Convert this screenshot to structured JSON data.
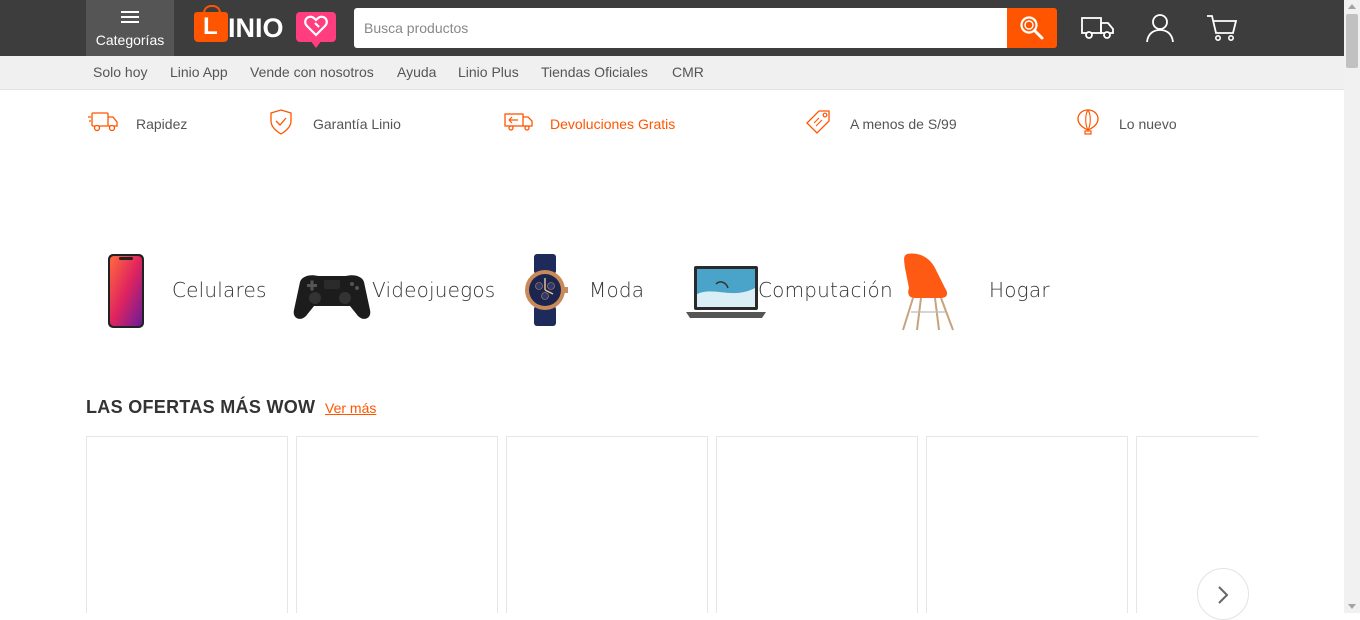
{
  "header": {
    "categories_label": "Categorías",
    "logo_text": "LINIO",
    "search_placeholder": "Busca productos",
    "icons": [
      "menu-icon",
      "search-icon",
      "truck-icon",
      "user-icon",
      "cart-icon"
    ],
    "accent_color": "#ff5500",
    "brand_pink": "#ff3d7f"
  },
  "subnav": {
    "items": [
      "Solo hoy",
      "Linio App",
      "Vende con nosotros",
      "Ayuda",
      "Linio Plus",
      "Tiendas Oficiales",
      "CMR"
    ]
  },
  "benefits": [
    {
      "label": "Rapidez",
      "icon": "fast-truck-icon"
    },
    {
      "label": "Garantía Linio",
      "icon": "shield-check-icon"
    },
    {
      "label": "Devoluciones Gratis",
      "icon": "return-truck-icon"
    },
    {
      "label": "A menos de S/99",
      "icon": "price-tag-icon"
    },
    {
      "label": "Lo nuevo",
      "icon": "balloon-icon"
    }
  ],
  "categories": [
    {
      "label": "Celulares",
      "icon": "smartphone-image"
    },
    {
      "label": "Videojuegos",
      "icon": "gamepad-image"
    },
    {
      "label": "Moda",
      "icon": "watch-image"
    },
    {
      "label": "Computación",
      "icon": "laptop-image"
    },
    {
      "label": "Hogar",
      "icon": "chair-image"
    }
  ],
  "deals": {
    "title": "LAS OFERTAS MÁS WOW",
    "link": "Ver más",
    "next_icon": "chevron-right-icon"
  }
}
